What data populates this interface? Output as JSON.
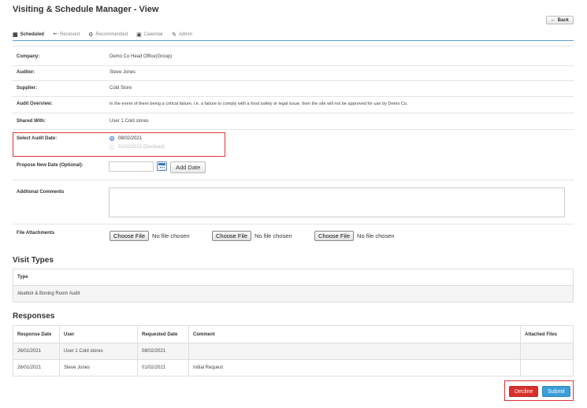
{
  "header": {
    "title": "Visiting & Schedule Manager - View",
    "back_label": "Back"
  },
  "tabs": [
    {
      "label": "Scheduled",
      "icon": "table-icon",
      "active": true
    },
    {
      "label": "Received",
      "icon": "arrow-left-icon",
      "active": false
    },
    {
      "label": "Recommended",
      "icon": "gear-icon",
      "active": false
    },
    {
      "label": "Calendar",
      "icon": "calendar-icon",
      "active": false
    },
    {
      "label": "Admin",
      "icon": "wrench-icon",
      "active": false
    }
  ],
  "form": {
    "company_label": "Company:",
    "company_value": "Demo Co Head Office(Group)",
    "auditor_label": "Auditor:",
    "auditor_value": "Steve Jones",
    "supplier_label": "Supplier:",
    "supplier_value": "Cold Store",
    "overview_label": "Audit Overview:",
    "overview_value": "In the event of there being a critical failure, i.e. a failure to comply with a food safety or legal issue, then the site will not be approved for use by Demo Co.",
    "shared_label": "Shared With:",
    "shared_value": "User 1 Cold stores",
    "audit_date_label": "Select Audit Date:",
    "audit_date_options": [
      {
        "label": "08/02/2021",
        "checked": true,
        "disabled": false
      },
      {
        "label": "01/02/2021 (Declined)",
        "checked": false,
        "disabled": true
      }
    ],
    "propose_label": "Propose New Date (Optional):",
    "propose_value": "",
    "add_date_label": "Add Date",
    "comments_label": "Additonal Comments",
    "comments_value": "",
    "files_label": "File Attachments",
    "file_inputs": [
      {
        "button": "Choose File",
        "status": "No file chosen"
      },
      {
        "button": "Choose File",
        "status": "No file chosen"
      },
      {
        "button": "Choose File",
        "status": "No file chosen"
      }
    ]
  },
  "visit_types": {
    "title": "Visit Types",
    "header": "Type",
    "rows": [
      "Abattoir & Boning Room Audit"
    ]
  },
  "responses": {
    "title": "Responses",
    "columns": [
      "Response Date",
      "User",
      "Requested Date",
      "Comment",
      "Attached Files"
    ],
    "rows": [
      [
        "26/01/2021",
        "User 1 Cold stores",
        "08/02/2021",
        "",
        ""
      ],
      [
        "26/01/2021",
        "Steve Jones",
        "01/02/2021",
        "Initial Request",
        ""
      ]
    ]
  },
  "actions": {
    "decline_label": "Decline",
    "submit_label": "Submit"
  },
  "colors": {
    "accent": "#3d9ed9",
    "danger": "#d9302c",
    "highlight": "#e0343a"
  }
}
